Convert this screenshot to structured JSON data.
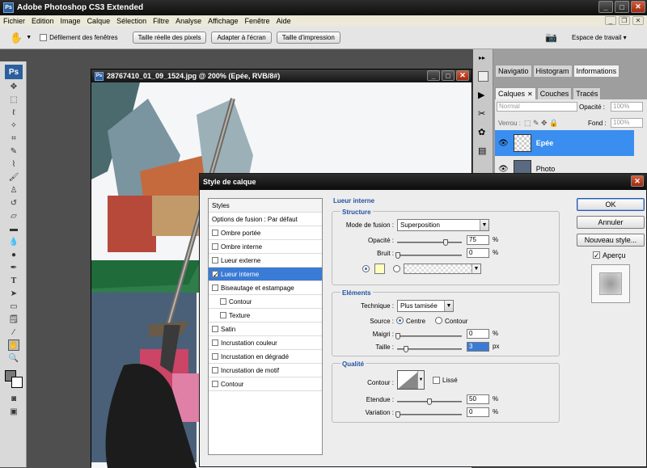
{
  "app": {
    "title": "Adobe Photoshop CS3 Extended",
    "logo": "Ps"
  },
  "menu": [
    "Fichier",
    "Edition",
    "Image",
    "Calque",
    "Sélection",
    "Filtre",
    "Analyse",
    "Affichage",
    "Fenêtre",
    "Aide"
  ],
  "options": {
    "scroll_all_label": "Défilement des fenêtres",
    "btn_actual": "Taille réelle des pixels",
    "btn_fit": "Adapter à l'écran",
    "btn_print": "Taille d'impression",
    "workspace": "Espace de travail ▾"
  },
  "document": {
    "title": "28767410_01_09_1524.jpg @ 200% (Epée, RVB/8#)"
  },
  "panels": {
    "tabs_top": [
      "Navigatio",
      "Histogram",
      "Informations"
    ],
    "tabs_layers": [
      "Calques",
      "Couches",
      "Tracés"
    ],
    "blend": "Normal",
    "opacity_label": "Opacité :",
    "opacity_value": "100%",
    "lock_label": "Verrou :",
    "fill_label": "Fond :",
    "fill_value": "100%",
    "layers": [
      {
        "name": "Epée",
        "selected": true
      },
      {
        "name": "Photo",
        "selected": false
      }
    ]
  },
  "dialog": {
    "title": "Style de calque",
    "list_header": "Styles",
    "list": [
      {
        "label": "Options de fusion : Par défaut",
        "check": false,
        "sub": false,
        "sel": false,
        "hascb": false
      },
      {
        "label": "Ombre portée",
        "check": false,
        "sub": false,
        "sel": false,
        "hascb": true
      },
      {
        "label": "Ombre interne",
        "check": false,
        "sub": false,
        "sel": false,
        "hascb": true
      },
      {
        "label": "Lueur externe",
        "check": false,
        "sub": false,
        "sel": false,
        "hascb": true
      },
      {
        "label": "Lueur interne",
        "check": true,
        "sub": false,
        "sel": true,
        "hascb": true
      },
      {
        "label": "Biseautage et estampage",
        "check": false,
        "sub": false,
        "sel": false,
        "hascb": true
      },
      {
        "label": "Contour",
        "check": false,
        "sub": true,
        "sel": false,
        "hascb": true
      },
      {
        "label": "Texture",
        "check": false,
        "sub": true,
        "sel": false,
        "hascb": true
      },
      {
        "label": "Satin",
        "check": false,
        "sub": false,
        "sel": false,
        "hascb": true
      },
      {
        "label": "Incrustation couleur",
        "check": false,
        "sub": false,
        "sel": false,
        "hascb": true
      },
      {
        "label": "Incrustation en dégradé",
        "check": false,
        "sub": false,
        "sel": false,
        "hascb": true
      },
      {
        "label": "Incrustation de motif",
        "check": false,
        "sub": false,
        "sel": false,
        "hascb": true
      },
      {
        "label": "Contour",
        "check": false,
        "sub": false,
        "sel": false,
        "hascb": true
      }
    ],
    "section": "Lueur interne",
    "structure": {
      "title": "Structure",
      "mode_label": "Mode de fusion :",
      "mode_value": "Superposition",
      "opacity_label": "Opacité :",
      "opacity_value": "75",
      "noise_label": "Bruit :",
      "noise_value": "0",
      "unit": "%"
    },
    "elements": {
      "title": "Eléments",
      "technique_label": "Technique :",
      "technique_value": "Plus tamisée",
      "source_label": "Source :",
      "source_center": "Centre",
      "source_edge": "Contour",
      "choke_label": "Maigri :",
      "choke_value": "0",
      "size_label": "Taille :",
      "size_value": "3",
      "unit_pct": "%",
      "unit_px": "px"
    },
    "quality": {
      "title": "Qualité",
      "contour_label": "Contour :",
      "smooth_label": "Lissé",
      "range_label": "Etendue :",
      "range_value": "50",
      "jitter_label": "Variation :",
      "jitter_value": "0",
      "unit": "%"
    },
    "buttons": {
      "ok": "OK",
      "cancel": "Annuler",
      "new_style": "Nouveau style...",
      "preview": "Aperçu"
    }
  }
}
